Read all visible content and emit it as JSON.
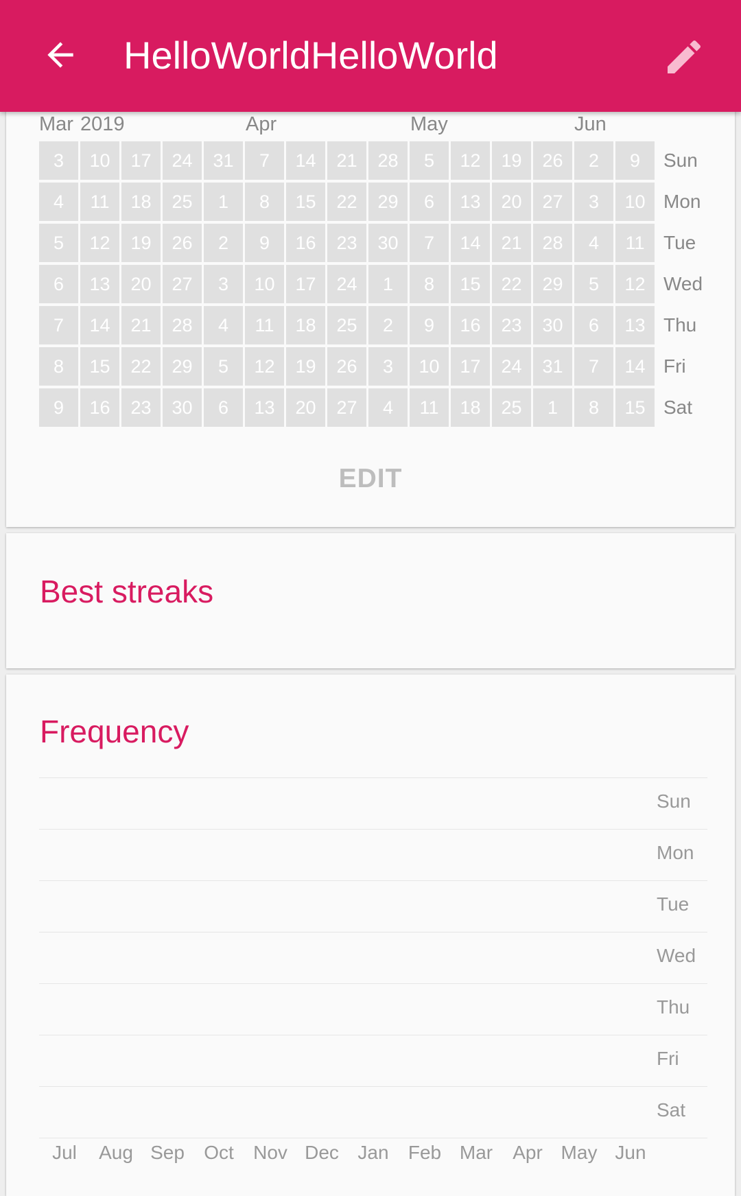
{
  "appbar": {
    "title": "HelloWorldHelloWorld",
    "back_icon": "arrow-left-icon",
    "edit_icon": "pencil-icon",
    "color": "#d81b60"
  },
  "history": {
    "month_labels": [
      "Mar",
      "2019",
      "Apr",
      "May",
      "Jun"
    ],
    "weeks": [
      [
        "3",
        "4",
        "5",
        "6",
        "7",
        "8",
        "9"
      ],
      [
        "10",
        "11",
        "12",
        "13",
        "14",
        "15",
        "16"
      ],
      [
        "17",
        "18",
        "19",
        "20",
        "21",
        "22",
        "23"
      ],
      [
        "24",
        "25",
        "26",
        "27",
        "28",
        "29",
        "30"
      ],
      [
        "31",
        "1",
        "2",
        "3",
        "4",
        "5",
        "6"
      ],
      [
        "7",
        "8",
        "9",
        "10",
        "11",
        "12",
        "13"
      ],
      [
        "14",
        "15",
        "16",
        "17",
        "18",
        "19",
        "20"
      ],
      [
        "21",
        "22",
        "23",
        "24",
        "25",
        "26",
        "27"
      ],
      [
        "28",
        "29",
        "30",
        "1",
        "2",
        "3",
        "4"
      ],
      [
        "5",
        "6",
        "7",
        "8",
        "9",
        "10",
        "11"
      ],
      [
        "12",
        "13",
        "14",
        "15",
        "16",
        "17",
        "18"
      ],
      [
        "19",
        "20",
        "21",
        "22",
        "23",
        "24",
        "25"
      ],
      [
        "26",
        "27",
        "28",
        "29",
        "30",
        "31",
        "1"
      ],
      [
        "2",
        "3",
        "4",
        "5",
        "6",
        "7",
        "8"
      ],
      [
        "9",
        "10",
        "11",
        "12",
        "13",
        "14",
        "15"
      ]
    ],
    "day_labels": [
      "Sun",
      "Mon",
      "Tue",
      "Wed",
      "Thu",
      "Fri",
      "Sat"
    ],
    "edit_label": "EDIT"
  },
  "streaks": {
    "title": "Best streaks"
  },
  "frequency": {
    "title": "Frequency",
    "day_labels": [
      "Sun",
      "Mon",
      "Tue",
      "Wed",
      "Thu",
      "Fri",
      "Sat"
    ],
    "month_labels": [
      "Jul",
      "Aug",
      "Sep",
      "Oct",
      "Nov",
      "Dec",
      "Jan",
      "Feb",
      "Mar",
      "Apr",
      "May",
      "Jun"
    ]
  }
}
